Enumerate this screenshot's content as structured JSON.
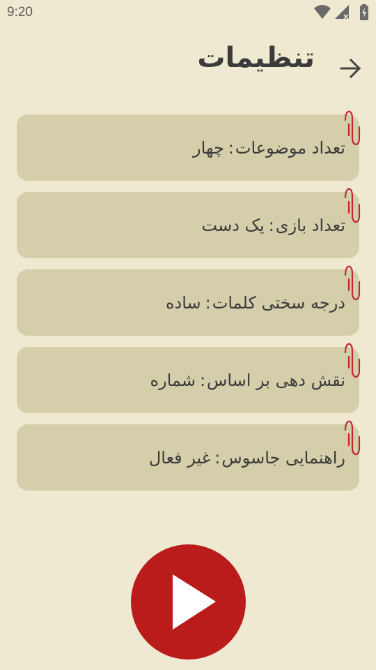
{
  "status_bar": {
    "time": "9:20",
    "icons": [
      "wifi-icon",
      "signal-icon",
      "battery-charging-icon"
    ]
  },
  "header": {
    "title": "تنظیمات",
    "back_icon": "arrow-right-icon"
  },
  "settings": [
    {
      "label": "تعداد موضوعات",
      "value": "چهار"
    },
    {
      "label": "تعداد بازی",
      "value": "یک دست"
    },
    {
      "label": "درجه سختی کلمات",
      "value": "ساده"
    },
    {
      "label": "نقش دهی بر اساس",
      "value": "شماره"
    },
    {
      "label": "راهنمایی جاسوس",
      "value": "غیر فعال"
    }
  ],
  "separator": ":",
  "play_icon": "play-icon",
  "colors": {
    "background": "#efe9d2",
    "card": "#d4ceab",
    "accent": "#ba1c1c",
    "clip": "#c4262c"
  }
}
